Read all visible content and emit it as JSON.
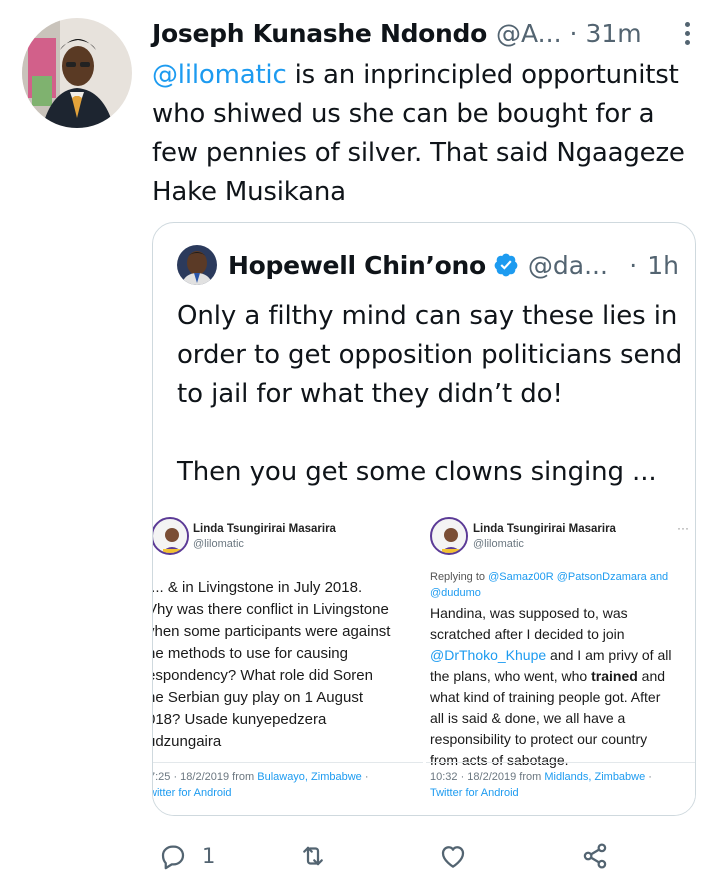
{
  "tweet": {
    "author_name": "Joseph Kunashe Ndondo",
    "author_handle": "@A...",
    "separator": "·",
    "time": "31m",
    "mention": "@lilomatic",
    "text_rest": " is an inprincipled opportunitst who shiwed us she can be bought for a few pennies of silver. That said Ngaageze Hake Musikana"
  },
  "quote": {
    "author_name": "Hopewell Chin’ono",
    "author_handle": "@da...",
    "separator": "·",
    "time": "1h",
    "paragraph1": "Only a filthy mind can say these lies in order to get opposition politicians send to jail for what they didn’t do!",
    "paragraph2": "Then you get some clowns singing ..."
  },
  "media": {
    "left": {
      "name": "Linda Tsungirirai Masarira",
      "handle": "@lilomatic",
      "lines": [
        "/... & in Livingstone in July 2018.",
        "Vhy was there conflict in Livingstone",
        "vhen some participants were against",
        "he methods to use for causing",
        "espondency? What role did Soren",
        "he Serbian guy play on 1 August",
        "018? Usade kunyepedzera",
        "udzungaira"
      ],
      "meta_time": "7:25 · 18/2/2019 from ",
      "meta_place": "Bulawayo, Zimbabwe",
      "meta_sep": " ·",
      "meta_client": "witter for Android"
    },
    "right": {
      "name": "Linda Tsungirirai Masarira",
      "handle": "@lilomatic",
      "more": "···",
      "reply_prefix": "Replying to ",
      "reply_targets": "@Samaz00R @PatsonDzamara and",
      "reply_line2": "@dudumo",
      "line1": "Handina, was supposed to, was",
      "line2": "scratched after I decided to join",
      "line3_mention": "@DrThoko_Khupe",
      "line3_rest": " and I am privy of all",
      "line4_a": "the plans, who went, who ",
      "line4_bold": "trained",
      "line4_b": " and",
      "line5": "what kind of training people got. After",
      "line6": "all is said & done, we all have a",
      "line7": "responsibility to protect our country",
      "line8": "from acts of sabotage.",
      "meta_time": "10:32 · 18/2/2019 from ",
      "meta_place": "Midlands, Zimbabwe",
      "meta_sep": " ·",
      "meta_client": "Twitter for Android"
    }
  },
  "actions": {
    "reply_count": "1"
  },
  "icons": {
    "reply": "reply-icon",
    "retweet": "retweet-icon",
    "like": "like-icon",
    "share": "share-icon",
    "verified": "verified-badge-icon",
    "more": "more-options-icon"
  },
  "colors": {
    "accent": "#1d9bf0",
    "secondary_text": "#536471",
    "border": "#cfd9de"
  }
}
